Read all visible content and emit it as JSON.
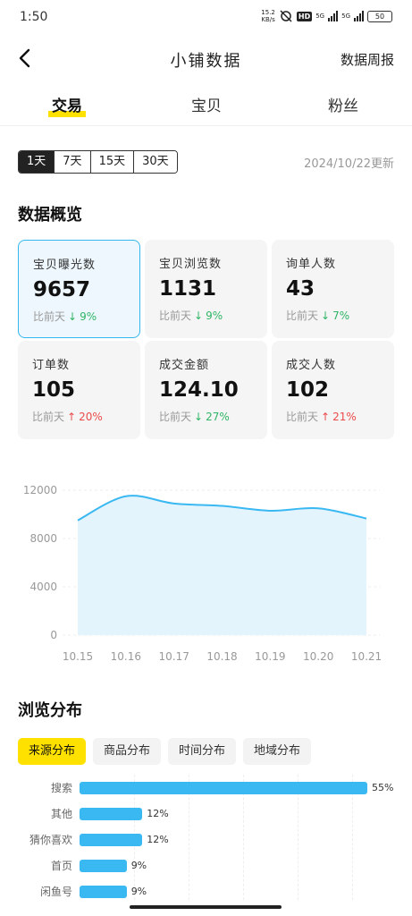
{
  "status_bar": {
    "time": "1:50",
    "net_speed_value": "15.2",
    "net_speed_unit": "KB/s",
    "hd_badge": "HD",
    "signal1": "5G",
    "signal2": "5G",
    "battery": "50"
  },
  "nav": {
    "title": "小铺数据",
    "weekly_report": "数据周报",
    "back_icon": "chevron-left-icon"
  },
  "tabs": [
    {
      "label": "交易",
      "active": true
    },
    {
      "label": "宝贝",
      "active": false
    },
    {
      "label": "粉丝",
      "active": false
    }
  ],
  "range": {
    "options": [
      "1天",
      "7天",
      "15天",
      "30天"
    ],
    "selected": "1天",
    "updated": "2024/10/22更新"
  },
  "overview": {
    "title": "数据概览",
    "compare_label": "比前天",
    "cards": [
      {
        "label": "宝贝曝光数",
        "value": "9657",
        "delta": "9%",
        "dir": "down",
        "selected": true
      },
      {
        "label": "宝贝浏览数",
        "value": "1131",
        "delta": "9%",
        "dir": "down",
        "selected": false
      },
      {
        "label": "询单人数",
        "value": "43",
        "delta": "7%",
        "dir": "down",
        "selected": false
      },
      {
        "label": "订单数",
        "value": "105",
        "delta": "20%",
        "dir": "up",
        "selected": false
      },
      {
        "label": "成交金额",
        "value": "124.10",
        "delta": "27%",
        "dir": "down",
        "selected": false
      },
      {
        "label": "成交人数",
        "value": "102",
        "delta": "21%",
        "dir": "up",
        "selected": false
      }
    ]
  },
  "chart_data": {
    "type": "area",
    "title": "",
    "x": [
      "10.15",
      "10.16",
      "10.17",
      "10.18",
      "10.19",
      "10.20",
      "10.21"
    ],
    "series": [
      {
        "values": [
          9500,
          11500,
          10900,
          10700,
          10300,
          10500,
          9657
        ]
      }
    ],
    "y_ticks": [
      "0",
      "4000",
      "8000",
      "12000"
    ],
    "ylim": [
      0,
      12000
    ],
    "grid": true,
    "colors": {
      "line": "#3ab8f2",
      "fill": "#e4f4fd"
    }
  },
  "distribution": {
    "title": "浏览分布",
    "tabs": [
      {
        "label": "来源分布",
        "active": true
      },
      {
        "label": "商品分布",
        "active": false
      },
      {
        "label": "时间分布",
        "active": false
      },
      {
        "label": "地域分布",
        "active": false
      }
    ],
    "bars": [
      {
        "label": "搜索",
        "pct": "55%",
        "value": 55
      },
      {
        "label": "其他",
        "pct": "12%",
        "value": 12
      },
      {
        "label": "猜你喜欢",
        "pct": "12%",
        "value": 12
      },
      {
        "label": "首页",
        "pct": "9%",
        "value": 9
      },
      {
        "label": "闲鱼号",
        "pct": "9%",
        "value": 9
      }
    ]
  },
  "colors": {
    "accent": "#ffe100",
    "brand_blue": "#3ab8f2",
    "up": "#ec4a4a",
    "down": "#2fb565"
  }
}
